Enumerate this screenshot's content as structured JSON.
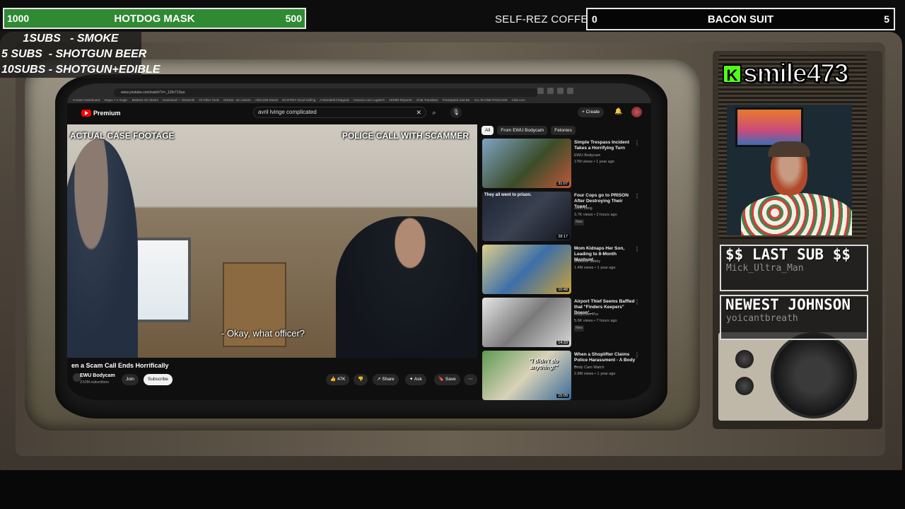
{
  "goals": {
    "left": {
      "start": "1000",
      "title": "HOTDOG MASK",
      "end": "500",
      "color": "#2f8a33"
    },
    "right": {
      "start": "0",
      "title": "BACON SUIT",
      "end": "5",
      "color": "#050505"
    },
    "coffee_label": "SELF-REZ COFFEE"
  },
  "promo": [
    "1SUBS   - SMOKE",
    "5 SUBS  - SHOTGUN BEER",
    "10SUBS - SHOTGUN+EDIBLE"
  ],
  "browser": {
    "url": "www.youtube.com/watch?v=_1Zfe71Suo",
    "bookmarks": [
      "Creator Dashboard",
      "Vegas 7 n magic",
      "Markets On Steam",
      "Download — Streamlit",
      "All Other Tools",
      "GitHub - air custom",
      "AlloC199 Steam",
      "ECOTINY Good Selling",
      "A Wonderful Magical",
      "Amazon.com Logitech",
      "VEMIR Reporter",
      "Chat Translator",
      "FreeSpeed Just Be",
      "ALL IN ONE PACKAGE",
      "Club.com"
    ]
  },
  "youtube": {
    "logo_text": "Premium",
    "search_value": "avril lvinge complicated",
    "clear_glyph": "✕",
    "search_glyph": "⌕",
    "mic_glyph": "🎙",
    "create_label": "+ Create",
    "bell_glyph": "🔔",
    "video": {
      "label_left": "ACTUAL CASE FOOTAGE",
      "label_right": "POLICE CALL WITH SCAMMER",
      "caption": "- Okay, what officer?",
      "title": "en a Scam Call Ends Horrifically",
      "channel": "EWU Bodycam",
      "subs": "3.52M subscribers",
      "join": "Join",
      "subscribe": "Subscribe",
      "likes": "👍 47K",
      "dislike": "👎",
      "share": "↗ Share",
      "ask": "✦ Ask",
      "save": "🔖 Save",
      "more": "⋯"
    },
    "chips": [
      "All",
      "From EWU Bodycam",
      "Felonies"
    ],
    "recs": [
      {
        "title": "Simple Trespass Incident Takes a Horrifying Turn",
        "channel": "EWU Bodycam",
        "meta": "17M views • 1 year ago",
        "dur": "31:07",
        "badge": ""
      },
      {
        "title": "Four Cops go to PRISON After Destroying Their Town!",
        "channel": "John Lang",
        "meta": "3.7K views • 2 hours ago",
        "dur": "28:17",
        "badge": "New",
        "overlay": "They all went to prison."
      },
      {
        "title": "Mom Kidnaps Her Son, Leading to 8-Month Manhunt",
        "channel": "Midwest Safety",
        "meta": "1.4M views • 1 year ago",
        "dur": "10:48",
        "badge": ""
      },
      {
        "title": "Airport Thief Seems Baffled that \"Finders Keepers\" Doesn'...",
        "channel": "BodyCam Pro",
        "meta": "5.6K views • 7 hours ago",
        "dur": "14:33",
        "badge": "New"
      },
      {
        "title": "When a Shoplifter Claims Police Harassment - A Body ...",
        "channel": "Body Cam Watch",
        "meta": "2.8M views • 1 year ago",
        "dur": "15:09",
        "badge": "",
        "overlay": "\"I didn't do anything!\""
      }
    ],
    "kebab": "⋮"
  },
  "stream": {
    "platform_letter": "K",
    "username": "smile473",
    "last_sub_label": "$$ LAST SUB $$",
    "last_sub_name": "Mick_Ultra_Man",
    "newest_label": "NEWEST JOHNSON",
    "newest_name": "yoicantbreath"
  }
}
